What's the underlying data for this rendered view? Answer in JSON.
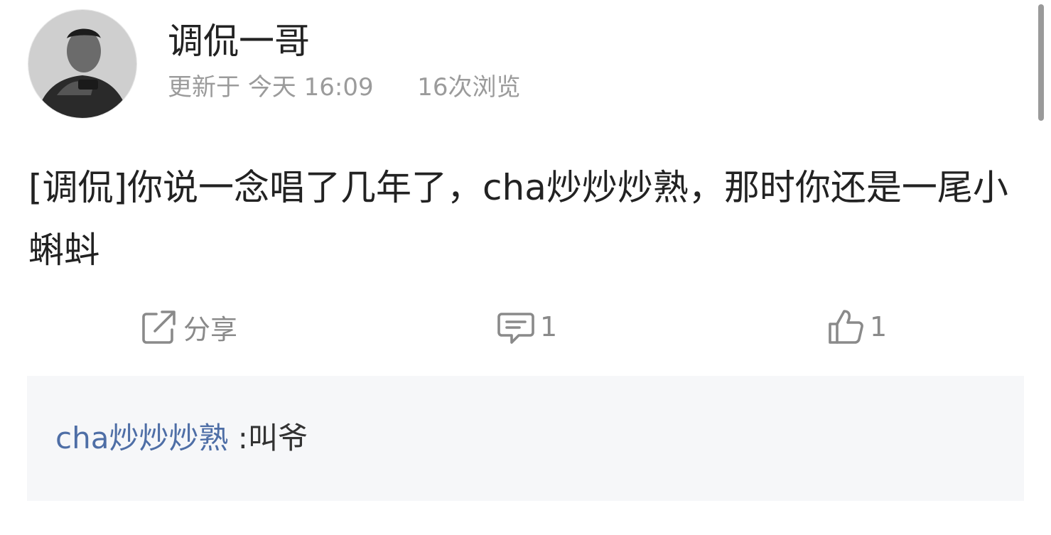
{
  "post": {
    "username": "调侃一哥",
    "updated_label": "更新于",
    "updated_time": "今天 16:09",
    "views": "16次浏览",
    "content": "[调侃]你说一念唱了几年了，cha炒炒炒熟，那时你还是一尾小蝌蚪"
  },
  "actions": {
    "share_label": "分享",
    "comment_count": "1",
    "like_count": "1"
  },
  "comment": {
    "user": "cha炒炒炒熟",
    "separator": " :",
    "text": "叫爷"
  },
  "icons": {
    "share": "share-icon",
    "comment": "comment-icon",
    "like": "thumbs-up-icon"
  },
  "colors": {
    "comment_user": "#4e6ea6",
    "meta_text": "#9b9b9b",
    "comment_background": "#f6f7f9"
  }
}
